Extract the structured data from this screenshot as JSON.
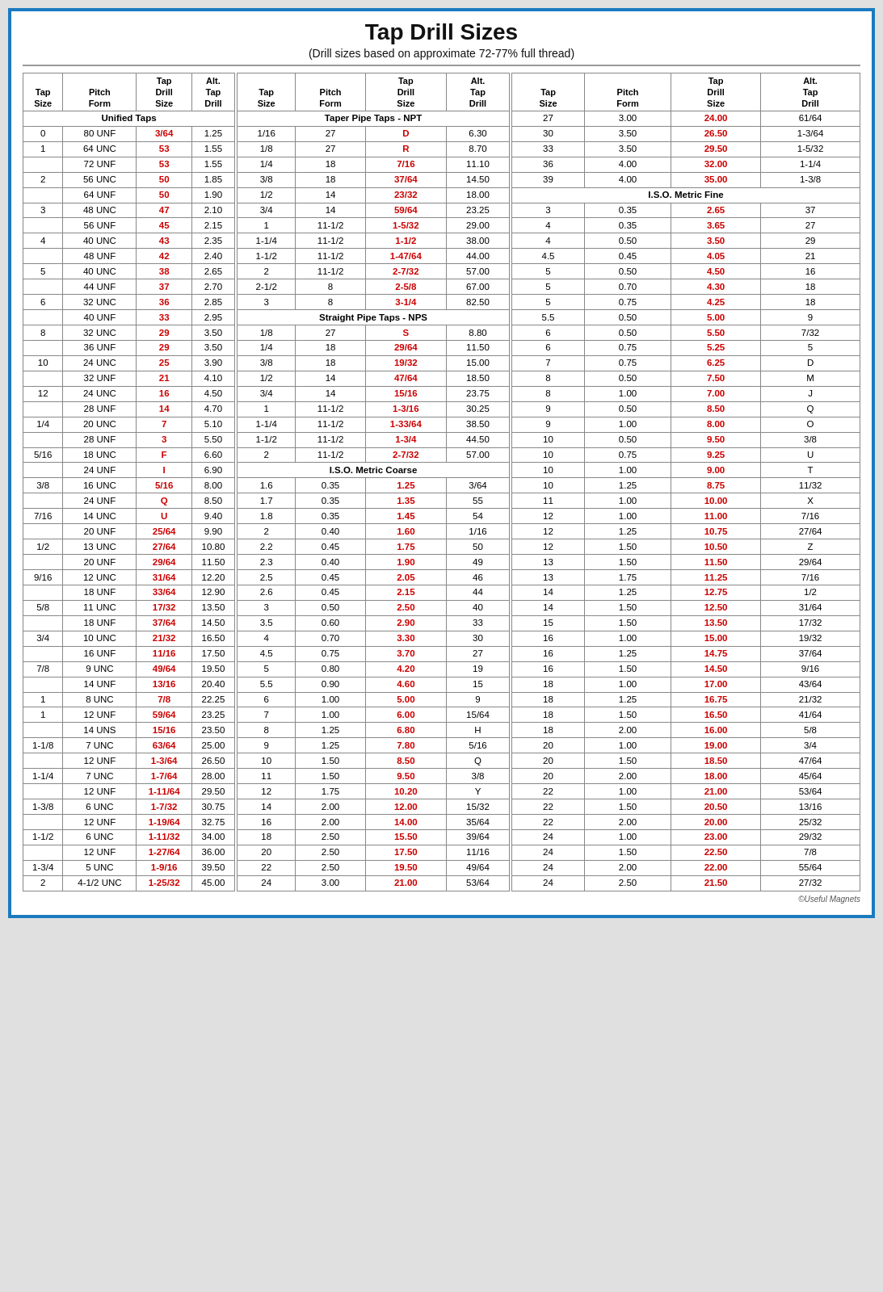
{
  "title": "Tap Drill Sizes",
  "subtitle": "(Drill sizes based on approximate 72-77% full thread)",
  "copyright": "©Useful Magnets",
  "headers": {
    "tap_size": "Tap Size",
    "pitch_form": "Pitch Form",
    "tap_drill_size": "Tap Drill Size",
    "alt_tap_drill": "Alt. Tap Drill"
  },
  "sections": {
    "unified": "Unified Taps",
    "taper_npt": "Taper Pipe Taps - NPT",
    "straight_nps": "Straight Pipe Taps - NPS",
    "iso_coarse": "I.S.O. Metric Coarse",
    "iso_fine": "I.S.O. Metric Fine"
  }
}
